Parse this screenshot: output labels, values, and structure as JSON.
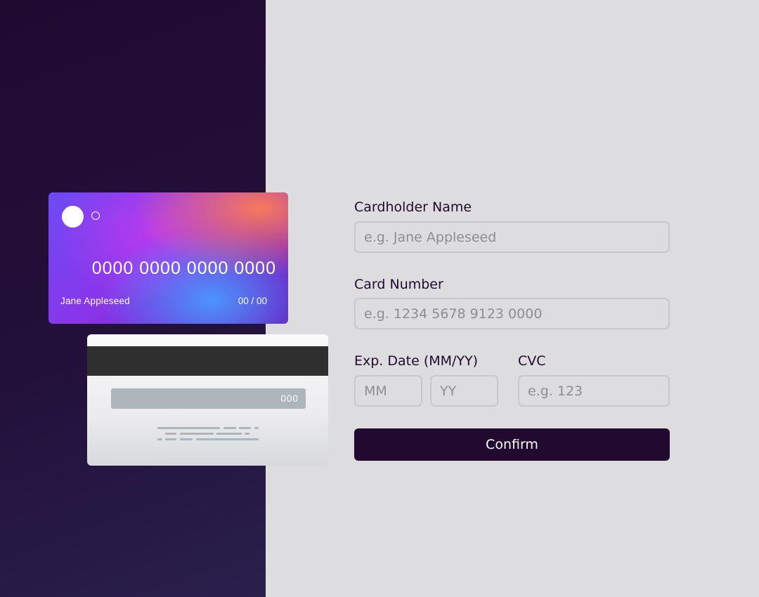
{
  "card_front": {
    "number": "0000 0000 0000 0000",
    "name": "Jane Appleseed",
    "expiry": "00 / 00"
  },
  "card_back": {
    "cvc": "000"
  },
  "form": {
    "cardholder_name": {
      "label": "Cardholder Name",
      "value": "",
      "placeholder": "e.g. Jane Appleseed"
    },
    "card_number": {
      "label": "Card Number",
      "value": "",
      "placeholder": "e.g. 1234 5678 9123 0000"
    },
    "exp_date": {
      "label": "Exp. Date (MM/YY)",
      "month_value": "",
      "month_placeholder": "MM",
      "year_value": "",
      "year_placeholder": "YY"
    },
    "cvc": {
      "label": "CVC",
      "value": "",
      "placeholder": "e.g. 123"
    },
    "confirm_label": "Confirm"
  },
  "colors": {
    "sidebar_bg": "#21092f",
    "page_bg": "#dddddf",
    "input_border": "#c8c8ca",
    "button_bg": "#21092f",
    "button_text": "#ffffff",
    "placeholder_text": "#8e8e90"
  }
}
